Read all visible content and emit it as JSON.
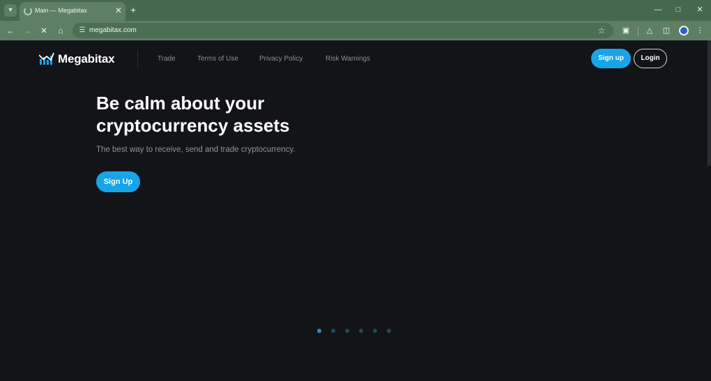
{
  "browser": {
    "tab_title": "Main — Megabitax",
    "url": "megabitax.com",
    "icons": {
      "tab_menu": "chevron-down-icon",
      "new_tab": "plus-icon",
      "back": "arrow-left-icon",
      "forward": "arrow-right-icon",
      "stop": "close-icon",
      "home": "home-icon",
      "site_info": "tune-icon",
      "bookmark": "star-icon",
      "extensions": "puzzle-icon",
      "labs": "flask-icon",
      "side_panel": "sidebar-icon",
      "profile": "profile-icon",
      "menu": "more-vertical-icon"
    }
  },
  "site": {
    "brand": "Megabitax",
    "nav": [
      {
        "label": "Trade"
      },
      {
        "label": "Terms of Use"
      },
      {
        "label": "Privacy Policy"
      },
      {
        "label": "Risk Warnings"
      }
    ],
    "signup_label": "Sign up",
    "login_label": "Login"
  },
  "hero": {
    "title_line1": "Be calm about your",
    "title_line2": "cryptocurrency assets",
    "subtitle": "The best way to receive, send and trade cryptocurrency.",
    "cta_label": "Sign Up"
  },
  "carousel": {
    "slide_count": 6,
    "active_index": 0
  },
  "colors": {
    "browser_frame": "#46694e",
    "page_bg": "#131418",
    "accent": "#17a4e8",
    "nav_text": "#8b8e96"
  }
}
